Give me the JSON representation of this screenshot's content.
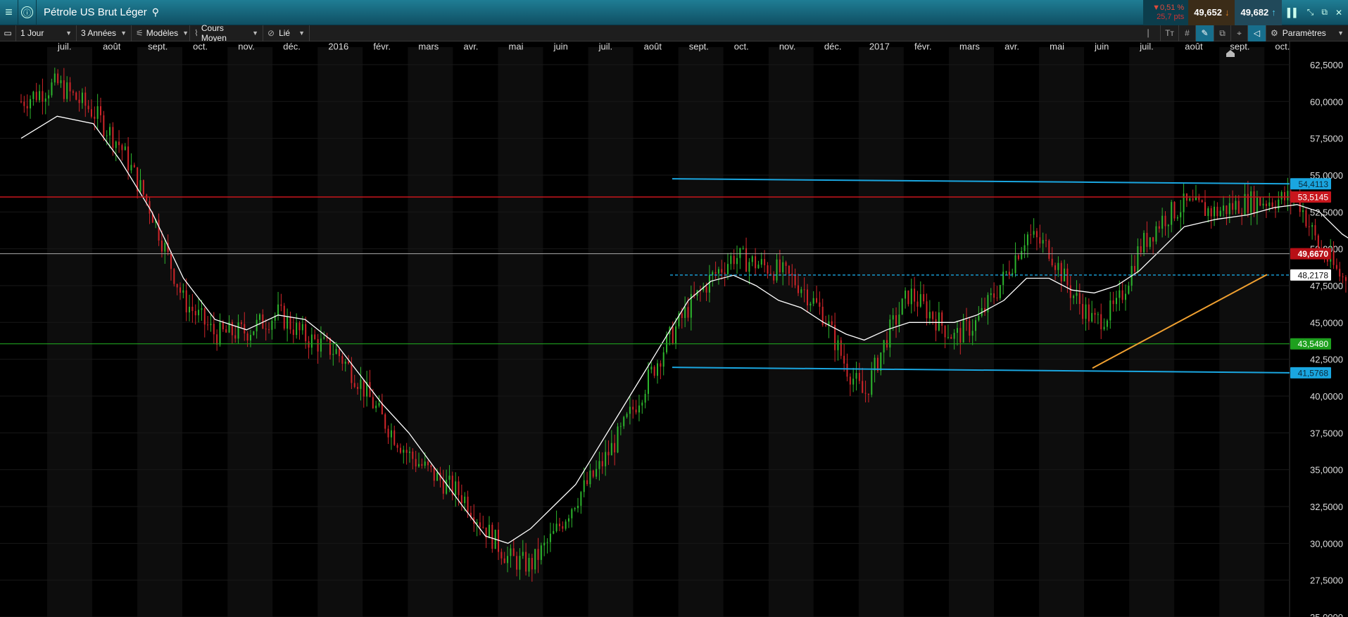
{
  "window": {
    "title": "Pétrole US Brut Léger",
    "info_icon": "ⓘ",
    "change_pct": "▼0,51 %",
    "change_pts": "25,7 pts",
    "bid": "49,652",
    "ask": "49,682"
  },
  "toolbar": {
    "interval": "1 Jour",
    "range": "3 Années",
    "models": "Modèles",
    "price_type": "Cours Moyen",
    "link": "Lié",
    "settings": "Paramètres"
  },
  "colors": {
    "channel": "#1aa6e0",
    "resistance": "#c8161d",
    "support": "#1ea01e",
    "trendline": "#f0a030",
    "bull": "#2db52d",
    "bear": "#d0252a",
    "ma": "#ffffff"
  },
  "chart_data": {
    "type": "candlestick",
    "instrument": "Pétrole US Brut Léger",
    "interval": "1 Jour",
    "ylim": [
      25000,
      63500
    ],
    "y_ticks": [
      "62,5000",
      "60,0000",
      "57,5000",
      "55,0000",
      "52,5000",
      "50,0000",
      "47,5000",
      "45,0000",
      "42,5000",
      "40,0000",
      "37,5000",
      "35,0000",
      "32,5000",
      "30,0000",
      "27,5000",
      "25,0000"
    ],
    "x_ticks": [
      "juil.",
      "août",
      "sept.",
      "oct.",
      "nov.",
      "déc.",
      "2016",
      "févr.",
      "mars",
      "avr.",
      "mai",
      "juin",
      "juil.",
      "août",
      "sept.",
      "oct.",
      "nov.",
      "déc.",
      "2017",
      "févr.",
      "mars",
      "avr.",
      "mai",
      "juin",
      "juil.",
      "août",
      "sept.",
      "oct."
    ],
    "price_path": [
      [
        0,
        60.0
      ],
      [
        0.8,
        61.2
      ],
      [
        1.6,
        59.3
      ],
      [
        2.2,
        57.0
      ],
      [
        2.9,
        52.5
      ],
      [
        3.6,
        46.5
      ],
      [
        4.3,
        44.2
      ],
      [
        5.0,
        44.4
      ],
      [
        5.7,
        45.6
      ],
      [
        6.3,
        44.0
      ],
      [
        7.0,
        43.0
      ],
      [
        7.5,
        41.0
      ],
      [
        8.0,
        38.5
      ],
      [
        8.6,
        36.0
      ],
      [
        9.2,
        34.5
      ],
      [
        9.8,
        33.2
      ],
      [
        10.3,
        31.0
      ],
      [
        10.8,
        29.0
      ],
      [
        11.3,
        28.5
      ],
      [
        11.8,
        30.5
      ],
      [
        12.3,
        33.0
      ],
      [
        12.8,
        35.0
      ],
      [
        13.3,
        37.5
      ],
      [
        13.8,
        40.5
      ],
      [
        14.3,
        43.5
      ],
      [
        14.8,
        46.0
      ],
      [
        15.3,
        48.0
      ],
      [
        15.8,
        49.5
      ],
      [
        16.3,
        49.0
      ],
      [
        16.8,
        48.5
      ],
      [
        17.3,
        47.5
      ],
      [
        17.8,
        45.5
      ],
      [
        18.3,
        42.0
      ],
      [
        18.7,
        40.0
      ],
      [
        19.2,
        44.0
      ],
      [
        19.7,
        47.0
      ],
      [
        20.2,
        45.5
      ],
      [
        20.7,
        44.0
      ],
      [
        21.2,
        45.0
      ],
      [
        21.8,
        48.0
      ],
      [
        22.3,
        51.0
      ],
      [
        22.8,
        50.0
      ],
      [
        23.3,
        47.0
      ],
      [
        23.8,
        45.0
      ],
      [
        24.3,
        46.0
      ],
      [
        24.8,
        50.0
      ],
      [
        25.3,
        52.0
      ],
      [
        25.8,
        53.0
      ],
      [
        26.5,
        52.5
      ],
      [
        27.2,
        53.2
      ],
      [
        27.8,
        53.3
      ],
      [
        28.3,
        53.5
      ],
      [
        28.8,
        50.0
      ],
      [
        29.3,
        48.0
      ],
      [
        29.8,
        49.0
      ],
      [
        30.3,
        52.0
      ],
      [
        30.8,
        52.0
      ],
      [
        31.3,
        49.0
      ],
      [
        31.8,
        48.0
      ],
      [
        32.3,
        51.0
      ],
      [
        32.8,
        47.5
      ],
      [
        33.3,
        45.5
      ],
      [
        33.7,
        42.8
      ],
      [
        34.2,
        45.5
      ],
      [
        34.7,
        48.0
      ],
      [
        35.2,
        50.0
      ],
      [
        35.7,
        48.5
      ],
      [
        36.2,
        48.0
      ],
      [
        36.7,
        49.0
      ],
      [
        37.2,
        47.5
      ],
      [
        37.7,
        48.8
      ],
      [
        38.0,
        49.8
      ]
    ],
    "moving_average_path": [
      [
        0,
        57.5
      ],
      [
        0.8,
        59.0
      ],
      [
        1.6,
        58.5
      ],
      [
        2.2,
        56.0
      ],
      [
        2.9,
        52.5
      ],
      [
        3.6,
        48.0
      ],
      [
        4.3,
        45.2
      ],
      [
        5.0,
        44.5
      ],
      [
        5.7,
        45.5
      ],
      [
        6.3,
        45.2
      ],
      [
        7.0,
        43.5
      ],
      [
        7.5,
        41.5
      ],
      [
        8.0,
        39.5
      ],
      [
        8.6,
        37.5
      ],
      [
        9.2,
        35.0
      ],
      [
        9.8,
        32.5
      ],
      [
        10.3,
        30.5
      ],
      [
        10.8,
        30.0
      ],
      [
        11.3,
        31.0
      ],
      [
        11.8,
        32.5
      ],
      [
        12.3,
        34.0
      ],
      [
        12.8,
        36.5
      ],
      [
        13.3,
        39.0
      ],
      [
        13.8,
        41.5
      ],
      [
        14.3,
        44.0
      ],
      [
        14.8,
        46.5
      ],
      [
        15.3,
        47.8
      ],
      [
        15.8,
        48.2
      ],
      [
        16.3,
        47.5
      ],
      [
        16.8,
        46.5
      ],
      [
        17.3,
        46.0
      ],
      [
        17.8,
        45.0
      ],
      [
        18.3,
        44.2
      ],
      [
        18.7,
        43.8
      ],
      [
        19.2,
        44.5
      ],
      [
        19.7,
        45.0
      ],
      [
        20.2,
        45.0
      ],
      [
        20.7,
        45.0
      ],
      [
        21.2,
        45.5
      ],
      [
        21.8,
        46.5
      ],
      [
        22.3,
        48.0
      ],
      [
        22.8,
        48.0
      ],
      [
        23.3,
        47.2
      ],
      [
        23.8,
        47.0
      ],
      [
        24.3,
        47.5
      ],
      [
        24.8,
        48.5
      ],
      [
        25.3,
        50.0
      ],
      [
        25.8,
        51.5
      ],
      [
        26.5,
        52.0
      ],
      [
        27.2,
        52.3
      ],
      [
        27.8,
        52.8
      ],
      [
        28.3,
        53.0
      ],
      [
        28.8,
        52.5
      ],
      [
        29.3,
        51.0
      ],
      [
        29.8,
        50.0
      ],
      [
        30.3,
        50.3
      ],
      [
        30.8,
        50.5
      ],
      [
        31.3,
        49.5
      ],
      [
        31.8,
        48.5
      ],
      [
        32.3,
        48.5
      ],
      [
        32.8,
        47.0
      ],
      [
        33.3,
        45.5
      ],
      [
        33.7,
        45.5
      ],
      [
        34.2,
        45.5
      ],
      [
        34.7,
        46.5
      ],
      [
        35.2,
        47.0
      ],
      [
        35.7,
        47.5
      ],
      [
        36.2,
        48.0
      ],
      [
        36.7,
        48.0
      ],
      [
        37.2,
        48.0
      ],
      [
        37.7,
        48.5
      ],
      [
        38.0,
        48.7
      ]
    ],
    "levels": [
      {
        "label": "54,4113",
        "value": 54.4113,
        "kind": "channel_top"
      },
      {
        "label": "53,5145",
        "value": 53.5145,
        "kind": "resistance"
      },
      {
        "label": "49,6670",
        "value": 49.667,
        "kind": "current_price"
      },
      {
        "label": "48,2178",
        "value": 48.2178,
        "kind": "dashed_level"
      },
      {
        "label": "43,5480",
        "value": 43.548,
        "kind": "support"
      },
      {
        "label": "41,5768",
        "value": 41.5768,
        "kind": "channel_bottom"
      }
    ],
    "channel_top": {
      "x": [
        24.0,
        48.0
      ],
      "y": [
        54.75,
        54.41
      ]
    },
    "channel_bottom": {
      "x": [
        24.0,
        48.0
      ],
      "y": [
        41.95,
        41.58
      ]
    },
    "trendline": {
      "x": [
        33.7,
        44.8
      ],
      "y": [
        41.9,
        48.25
      ]
    }
  }
}
